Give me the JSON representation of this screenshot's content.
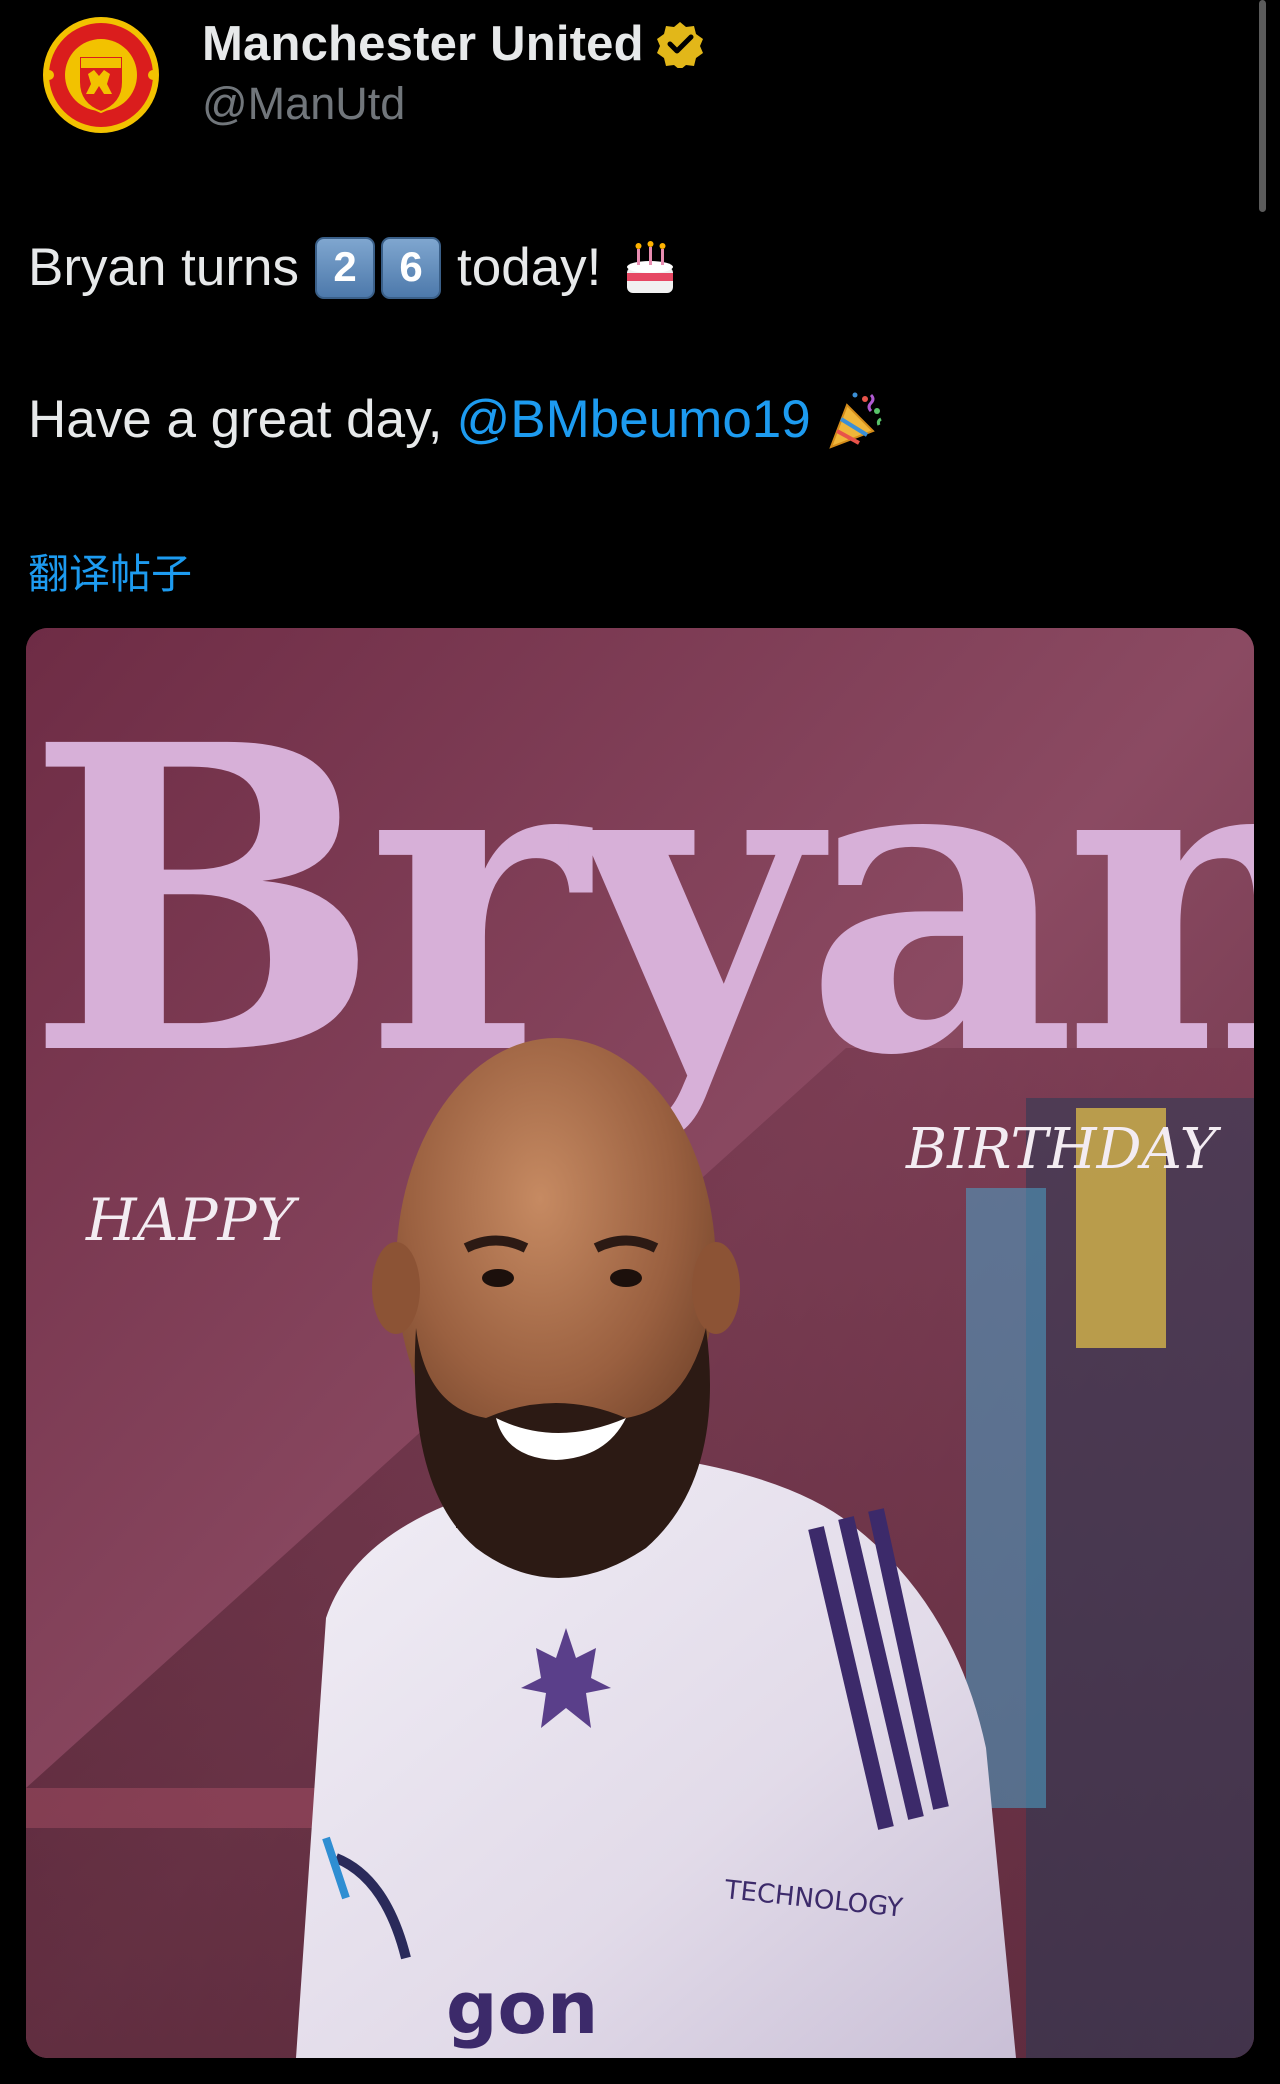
{
  "account": {
    "display_name": "Manchester United",
    "handle": "@ManUtd",
    "verified": true,
    "verified_badge_color": "#e2b719",
    "avatar_icon": "manchester-united-crest-icon"
  },
  "tweet": {
    "line1_prefix": "Bryan turns",
    "keycap_digits": [
      "2",
      "6"
    ],
    "line1_suffix": "today!",
    "line1_emoji": "birthday-cake-icon",
    "line2_prefix": "Have a great day,",
    "mention": "@BMbeumo19",
    "line2_emoji": "party-popper-icon",
    "translate_link": "翻译帖子"
  },
  "media": {
    "title_word": "Bryan",
    "label_left": "HAPPY",
    "label_right": "BIRTHDAY",
    "sponsor_sleeve": "TECHNOLOGY",
    "sponsor_front": "gon"
  },
  "colors": {
    "background": "#000000",
    "text": "#e7e9ea",
    "secondary_text": "#71767b",
    "link": "#1d9bf0",
    "poster_wall": "#7a3850",
    "poster_lettering": "#d7b0d8"
  }
}
